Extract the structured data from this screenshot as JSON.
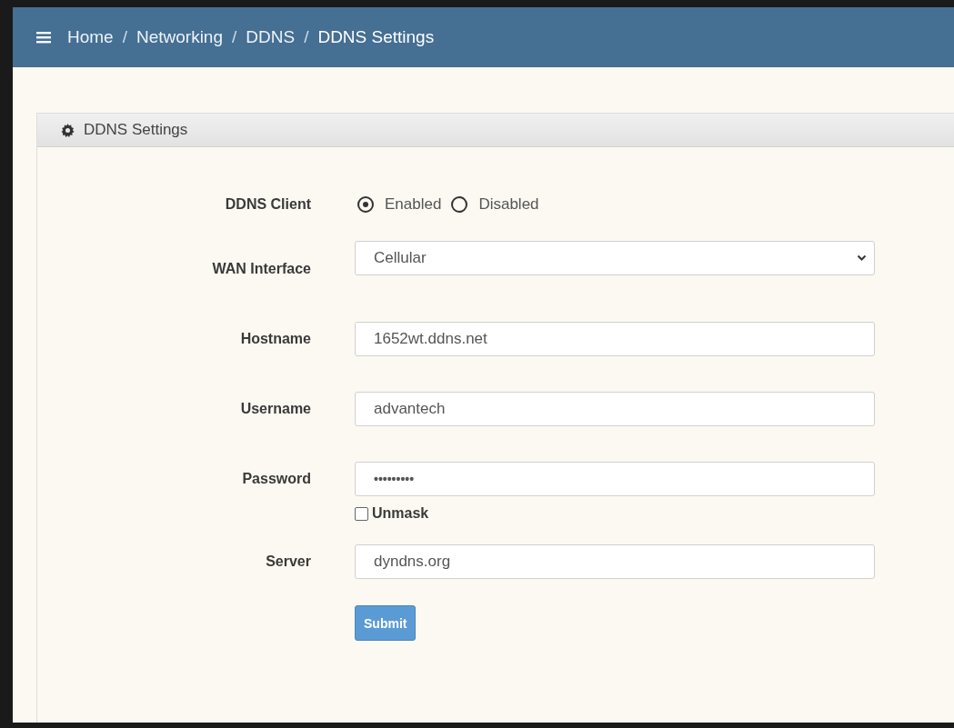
{
  "breadcrumb": [
    "Home",
    "Networking",
    "DDNS",
    "DDNS Settings"
  ],
  "breadcrumb_separator": "/",
  "panel": {
    "title": "DDNS Settings"
  },
  "fields": [
    {
      "kind": "radio",
      "label": "DDNS Client",
      "options": [
        {
          "label": "Enabled",
          "selected": true
        },
        {
          "label": "Disabled",
          "selected": false
        }
      ]
    },
    {
      "kind": "select",
      "label": "WAN Interface",
      "value": "Cellular"
    },
    {
      "kind": "text",
      "label": "Hostname",
      "value": "1652wt.ddns.net"
    },
    {
      "kind": "text",
      "label": "Username",
      "value": "advantech"
    },
    {
      "kind": "password",
      "label": "Password",
      "value": "•••••••••",
      "unmask": {
        "label": "Unmask",
        "checked": false
      }
    },
    {
      "kind": "text",
      "label": "Server",
      "value": "dyndns.org"
    }
  ],
  "submit": "Submit"
}
